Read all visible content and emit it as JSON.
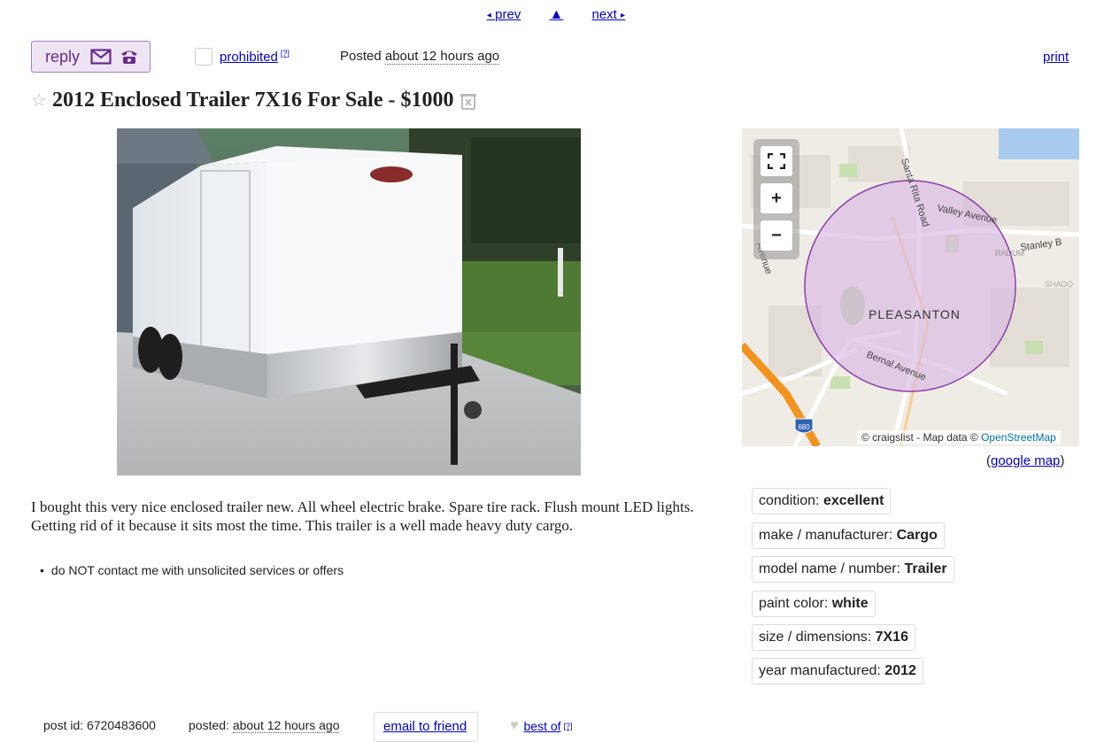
{
  "nav": {
    "prev_label": "prev",
    "up_label": "▲",
    "next_label": "next"
  },
  "reply": {
    "label": "reply"
  },
  "flag": {
    "prohibited_label": "prohibited",
    "help_mark": "[?]"
  },
  "posted": {
    "prefix": "Posted",
    "time": "about 12 hours ago"
  },
  "print_label": "print",
  "title": "2012 Enclosed Trailer 7X16 For Sale - $1000",
  "map": {
    "city_label": "PLEASANTON",
    "roads": [
      "Santa Rita Road",
      "Valley Avenue",
      "Stanley B",
      "Bernal Avenue",
      "Avenue",
      "RADUM",
      "SHADO"
    ],
    "highway_shield": "680",
    "attribution_prefix": "© craigslist - Map data ©",
    "attribution_link": "OpenStreetMap",
    "google_map_label": "google map",
    "google_map_open": "(",
    "google_map_close": ")"
  },
  "description": "I bought this very nice enclosed trailer new. All wheel electric brake. Spare tire rack. Flush mount LED lights. Getting rid of it because it sits most the time. This trailer is a well made heavy duty cargo.",
  "notice": "do NOT contact me with unsolicited services or offers",
  "attributes": [
    {
      "label": "condition: ",
      "value": "excellent"
    },
    {
      "label": "make / manufacturer: ",
      "value": "Cargo"
    },
    {
      "label": "model name / number: ",
      "value": "Trailer"
    },
    {
      "label": "paint color: ",
      "value": "white"
    },
    {
      "label": "size / dimensions: ",
      "value": "7X16"
    },
    {
      "label": "year manufactured: ",
      "value": "2012"
    }
  ],
  "footer": {
    "post_id_label": "post id: ",
    "post_id": "6720483600",
    "posted_label": "posted: ",
    "posted_time": "about 12 hours ago",
    "email_label": "email to friend",
    "best_of_label": "best of",
    "help_mark": "[?]"
  },
  "colors": {
    "accent_purple": "#6a2a8c",
    "link_blue": "#0000cc",
    "map_circle": "#8b3fa8"
  },
  "icons": [
    "mail-icon",
    "phone-icon",
    "star-icon",
    "hide-icon",
    "heart-icon",
    "fullscreen-icon",
    "zoom-in-icon",
    "zoom-out-icon"
  ]
}
